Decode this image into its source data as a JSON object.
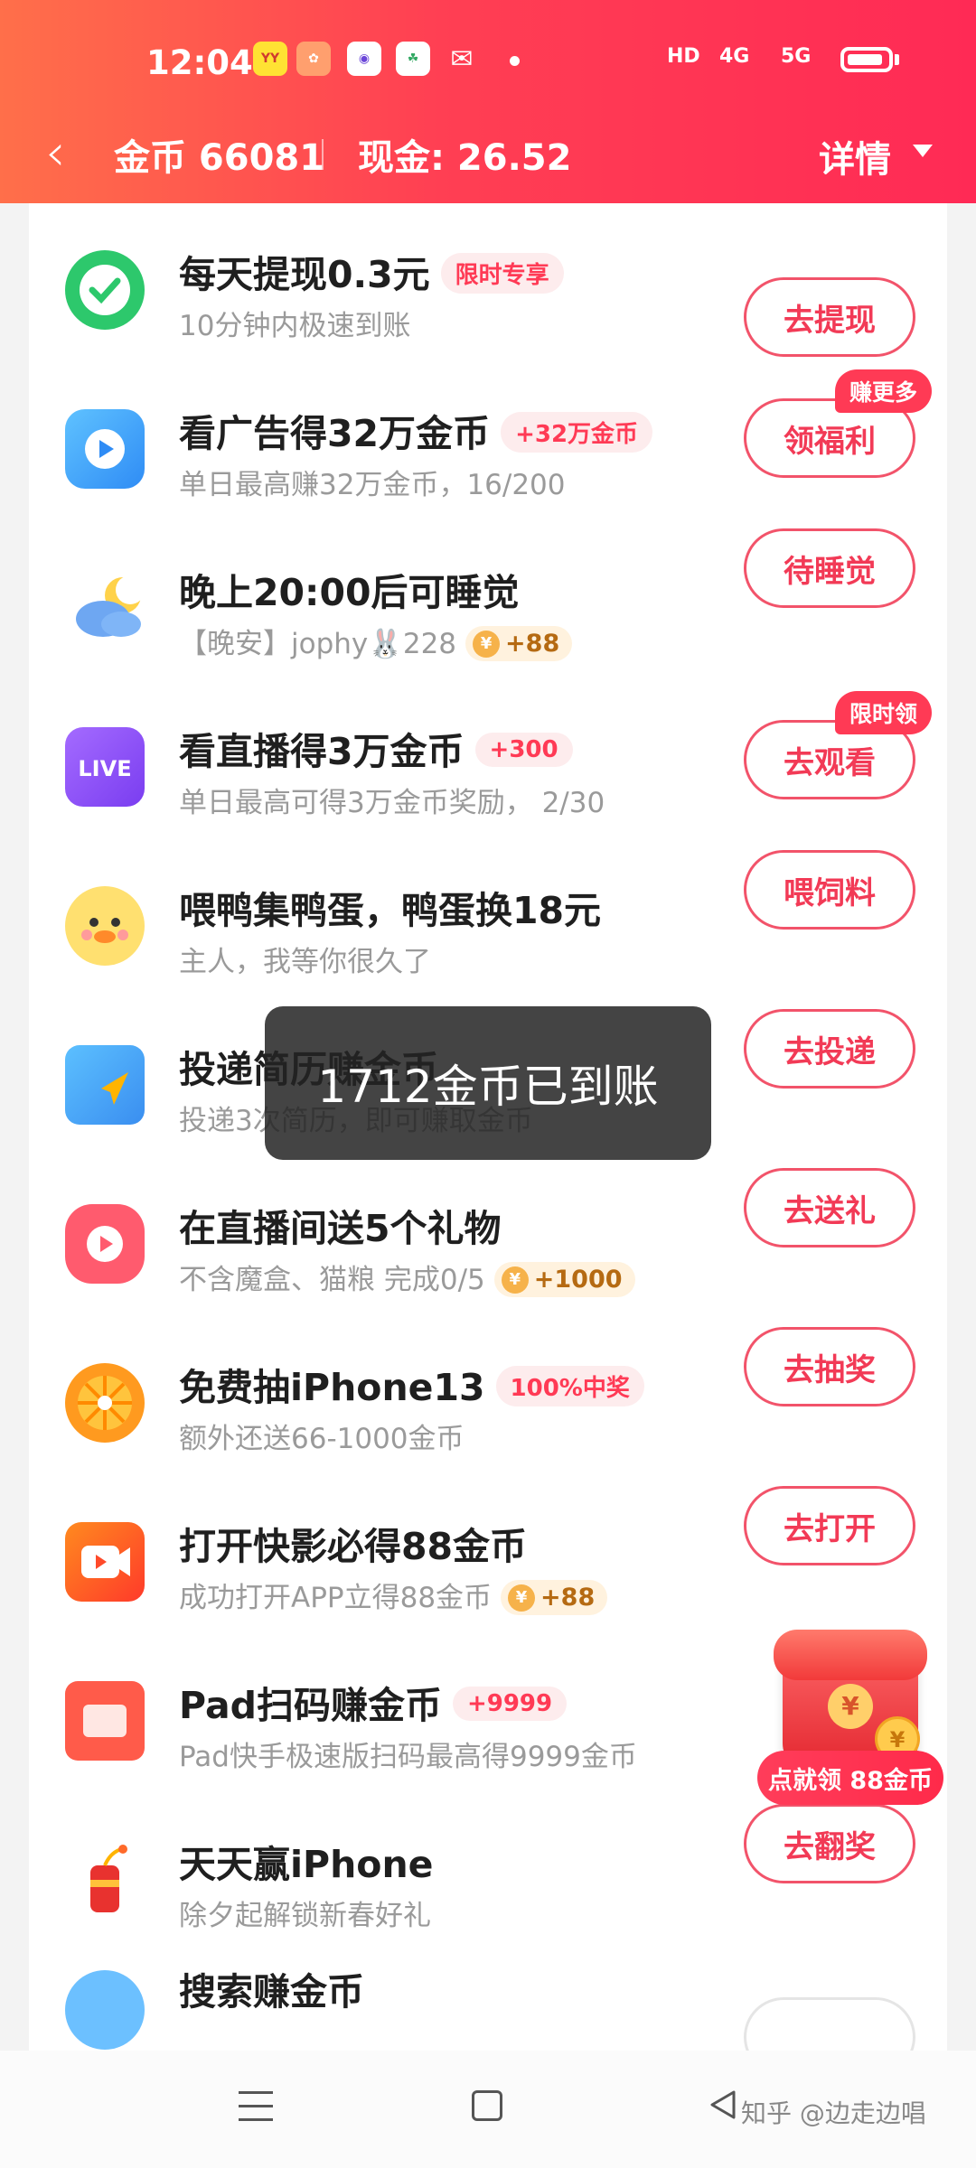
{
  "status_bar": {
    "time": "12:04",
    "app_icons": [
      "yy-app-icon",
      "album-app-icon",
      "browser-app-icon",
      "game-app-icon",
      "wechat-icon"
    ],
    "network": [
      "HD",
      "4G",
      "5G"
    ]
  },
  "header": {
    "back_label": "‹",
    "coins": "金币 66081",
    "cash": "现金: 26.52",
    "detail": "详情"
  },
  "tasks": [
    {
      "title": "每天提现0.3元",
      "tag": "限时专享",
      "sub": "10分钟内极速到账",
      "button": "去提现",
      "icon": "wechat-pay-icon"
    },
    {
      "title": "看广告得32万金币",
      "tag": "+32万金币",
      "sub": "单日最高赚32万金币，16/200",
      "button": "领福利",
      "corner": "赚更多",
      "icon": "video-play-icon"
    },
    {
      "title": "晚上20:00后可睡觉",
      "sub": "【晚安】jophy🐰228",
      "coin": "+88",
      "button": "待睡觉",
      "icon": "moon-cloud-icon"
    },
    {
      "title": "看直播得3万金币",
      "tag": "+300",
      "sub": "单日最高可得3万金币奖励， 2/30",
      "button": "去观看",
      "corner": "限时领",
      "icon": "live-tv-icon"
    },
    {
      "title": "喂鸭集鸭蛋，鸭蛋换18元",
      "sub": "主人，我等你很久了",
      "button": "喂饲料",
      "icon": "duck-icon"
    },
    {
      "title": "投递简历赚金币",
      "sub": "投递3次简历，即可赚取金币",
      "button": "去投递",
      "icon": "resume-send-icon"
    },
    {
      "title": "在直播间送5个礼物",
      "sub": "不含魔盒、猫粮 完成0/5",
      "coin": "+1000",
      "button": "去送礼",
      "icon": "gift-live-icon"
    },
    {
      "title": "免费抽iPhone13",
      "tag": "100%中奖",
      "sub": "额外还送66-1000金币",
      "button": "去抽奖",
      "icon": "lottery-wheel-icon"
    },
    {
      "title": "打开快影必得88金币",
      "sub": "成功打开APP立得88金币",
      "coin": "+88",
      "button": "去打开",
      "icon": "kuaiying-icon"
    },
    {
      "title": "Pad扫码赚金币",
      "tag": "+9999",
      "sub": "Pad快手极速版扫码最高得9999金币",
      "button": "",
      "icon": "pad-icon"
    },
    {
      "title": "天天赢iPhone",
      "sub": "除夕起解锁新春好礼",
      "button": "去翻奖",
      "icon": "firecracker-icon"
    },
    {
      "title": "搜索赚金币",
      "sub": "",
      "button": "",
      "icon": "search-icon"
    }
  ],
  "toast": "1712金币已到账",
  "floating": {
    "label": "点就领 88金币",
    "seal": "¥",
    "coin": "¥"
  },
  "watermark": "知乎 @边走边唱",
  "coin_symbol": "¥",
  "colors": {
    "brand": "#ff2f55",
    "button": "#f23a56",
    "tag_bg": "#fdeced"
  }
}
